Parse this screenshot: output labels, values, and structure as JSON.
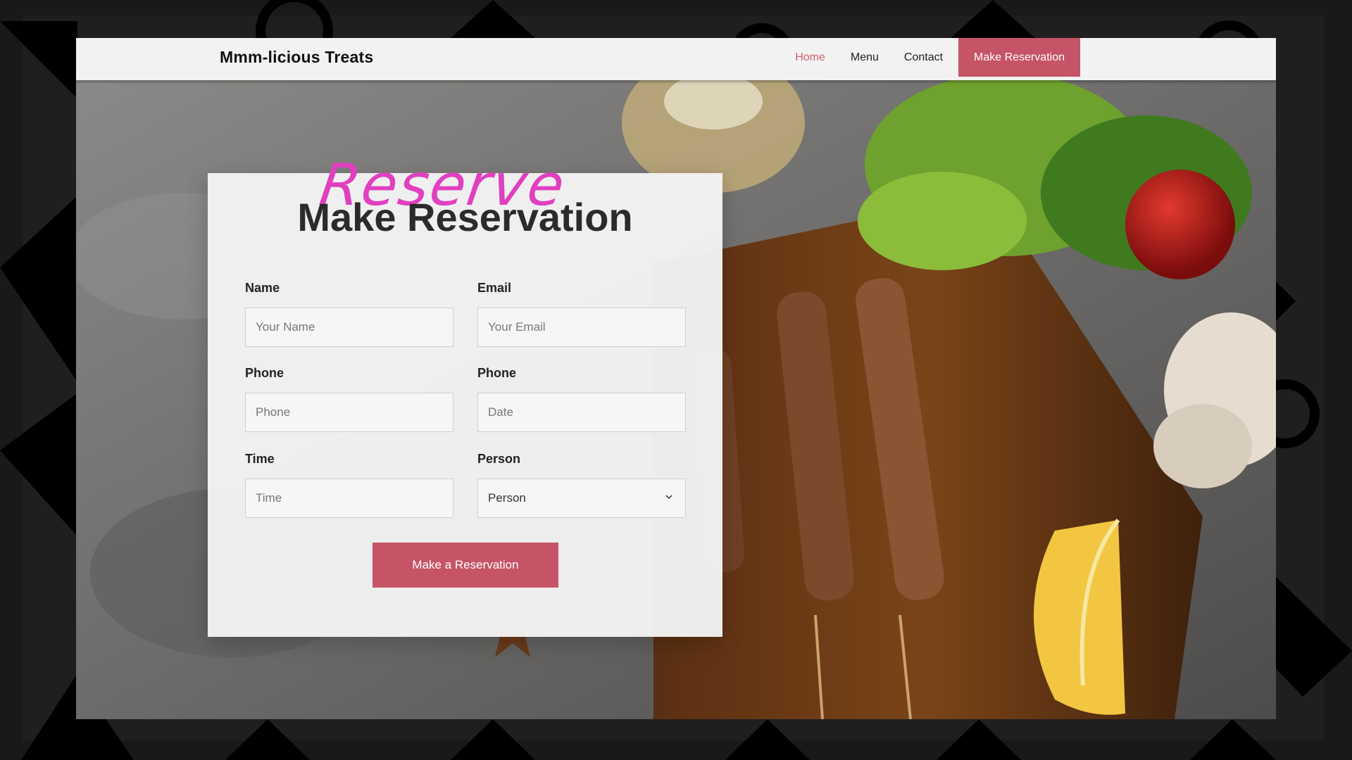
{
  "brand": {
    "name": "Mmm-licious Treats"
  },
  "nav": {
    "items": [
      {
        "label": "Home",
        "active": true
      },
      {
        "label": "Menu"
      },
      {
        "label": "Contact"
      }
    ],
    "cta_label": "Make Reservation"
  },
  "form": {
    "script_word": "Reserve",
    "title": "Make Reservation",
    "fields": {
      "name": {
        "label": "Name",
        "placeholder": "Your Name"
      },
      "email": {
        "label": "Email",
        "placeholder": "Your Email"
      },
      "phone": {
        "label": "Phone",
        "placeholder": "Phone"
      },
      "date": {
        "label": "Phone",
        "placeholder": "Date"
      },
      "time": {
        "label": "Time",
        "placeholder": "Time"
      },
      "person": {
        "label": "Person",
        "selected": "Person"
      }
    },
    "submit_label": "Make a Reservation"
  },
  "colors": {
    "accent": "#c65466",
    "active_link": "#cc5f6d",
    "script": "#e040c0"
  }
}
